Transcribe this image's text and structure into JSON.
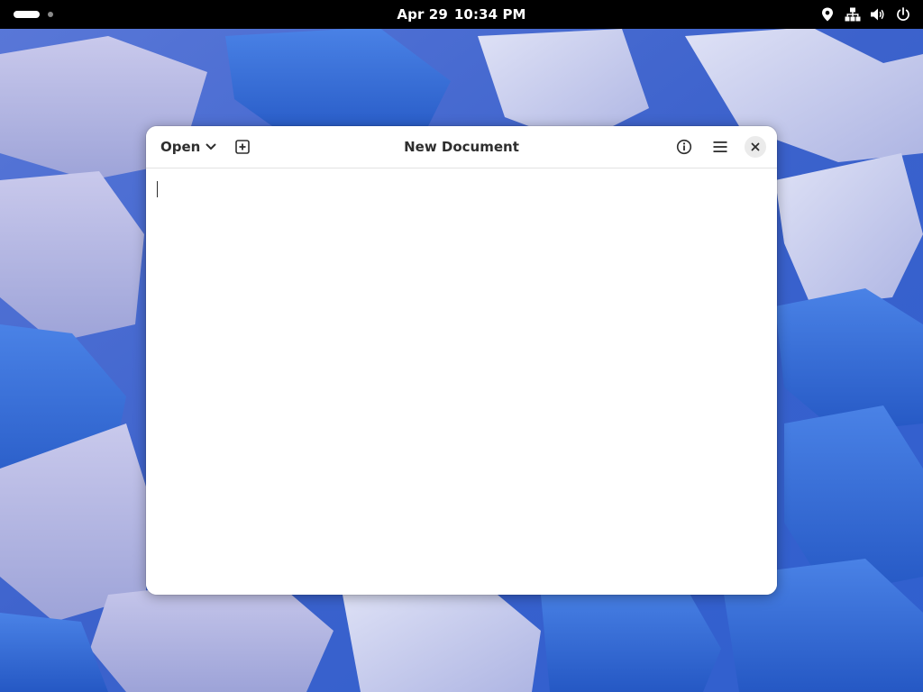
{
  "top_bar": {
    "workspaces": {
      "count": 2,
      "active_index": 0
    },
    "clock": {
      "date": "Apr 29",
      "time": "10:34 PM"
    },
    "status_icons": [
      "location-icon",
      "network-wired-icon",
      "volume-icon",
      "power-icon"
    ]
  },
  "window": {
    "title": "New Document",
    "header": {
      "open_label": "Open",
      "new_tab_icon": "new-tab-icon",
      "info_icon": "info-icon",
      "menu_icon": "hamburger-menu-icon",
      "close_icon": "close-icon"
    },
    "editor": {
      "text": ""
    }
  },
  "colors": {
    "top_bar_bg": "#000000",
    "window_bg": "#ffffff",
    "header_text": "#2e2e2e",
    "wallpaper_dark_blue": "#2f5fcf",
    "wallpaper_light_lavender": "#b9b9e2"
  }
}
